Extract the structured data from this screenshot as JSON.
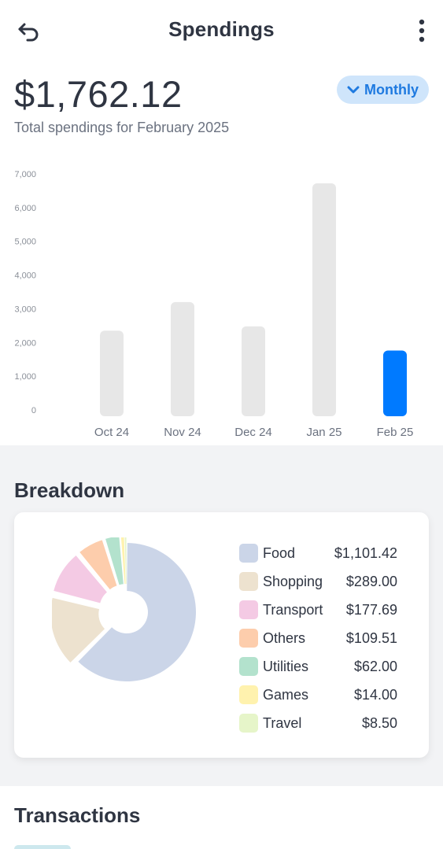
{
  "header": {
    "title": "Spendings",
    "back_icon": "undo-arrow-icon",
    "menu_icon": "vertical-dots-icon"
  },
  "summary": {
    "total": "$1,762.12",
    "subtitle": "Total spendings for February 2025",
    "period_label": "Monthly",
    "period_icon": "chevron-down-icon"
  },
  "colors": {
    "accent": "#007aff",
    "bar_inactive": "#e7e7e7",
    "period_bg": "#cfe5fb"
  },
  "chart_data": {
    "type": "bar",
    "categories": [
      "Oct 24",
      "Nov 24",
      "Dec 24",
      "Jan 25",
      "Feb 25"
    ],
    "values": [
      2350,
      3200,
      2480,
      6720,
      1762.12
    ],
    "highlight_index": 4,
    "y_ticks": [
      "0",
      "1,000",
      "2,000",
      "3,000",
      "4,000",
      "5,000",
      "6,000",
      "7,000"
    ],
    "ylim": [
      0,
      7000
    ],
    "grid": false
  },
  "breakdown": {
    "title": "Breakdown",
    "items": [
      {
        "label": "Food",
        "value": "$1,101.42",
        "amount": 1101.42,
        "color": "#cbd5e8"
      },
      {
        "label": "Shopping",
        "value": "$289.00",
        "amount": 289.0,
        "color": "#ede2cf"
      },
      {
        "label": "Transport",
        "value": "$177.69",
        "amount": 177.69,
        "color": "#f4cae4"
      },
      {
        "label": "Others",
        "value": "$109.51",
        "amount": 109.51,
        "color": "#fdcdac"
      },
      {
        "label": "Utilities",
        "value": "$62.00",
        "amount": 62.0,
        "color": "#b3e2cd"
      },
      {
        "label": "Games",
        "value": "$14.00",
        "amount": 14.0,
        "color": "#fff2ae"
      },
      {
        "label": "Travel",
        "value": "$8.50",
        "amount": 8.5,
        "color": "#e6f5c9"
      }
    ]
  },
  "transactions": {
    "title": "Transactions"
  }
}
